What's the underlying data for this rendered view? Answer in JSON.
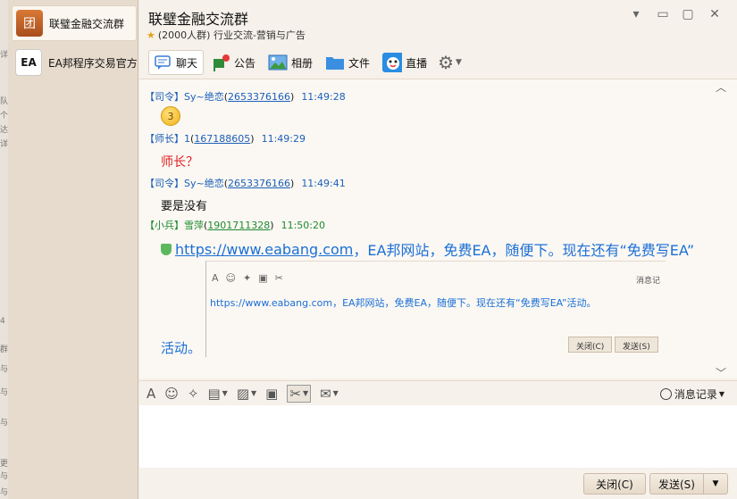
{
  "left_strip": [
    "详",
    "队",
    "个",
    "达",
    "详",
    "4",
    "群",
    "与",
    "与",
    "与",
    "更",
    "与",
    "与"
  ],
  "conversations": [
    {
      "name": "联璧金融交流群",
      "avatar_text": "团",
      "active": true
    },
    {
      "name": "EA邦程序交易官方",
      "avatar_text": "EA",
      "active": false
    }
  ],
  "header": {
    "title": "联璧金融交流群",
    "subtitle": "(2000人群) 行业交流-营销与广告"
  },
  "window_controls": {
    "dropdown": "▾",
    "minimize": "▭",
    "maximize": "▢",
    "close": "✕"
  },
  "tabs": [
    {
      "label": "聊天",
      "icon": "chat-icon"
    },
    {
      "label": "公告",
      "icon": "announcement-icon"
    },
    {
      "label": "相册",
      "icon": "album-icon"
    },
    {
      "label": "文件",
      "icon": "folder-icon"
    },
    {
      "label": "直播",
      "icon": "live-icon"
    }
  ],
  "messages": [
    {
      "rank": "【司令】",
      "name": "Sy~绝恋",
      "id": "2653376166",
      "time": "11:49:28",
      "body": "",
      "emoji": true
    },
    {
      "rank": "【师长】",
      "name": "1",
      "id": "167188605",
      "time": "11:49:29",
      "body": "师长？"
    },
    {
      "rank": "【司令】",
      "name": "Sy~绝恋",
      "id": "2653376166",
      "time": "11:49:41",
      "body": "要是没有"
    },
    {
      "rank": "【小兵】",
      "name": "雪萍",
      "id": "1901711328",
      "time": "11:50:20",
      "body": ""
    }
  ],
  "ea_message": {
    "link": "https://www.eabang.com",
    "text": "，EA邦网站，免费EA，随便下。现在还有“免费写EA”",
    "continuation": "活动。"
  },
  "embedded": {
    "text": "https://www.eabang.com，EA邦网站，免费EA，随便下。现在还有“免费写EA”活动。",
    "record_label": "消息记",
    "close_label": "关闭(C)",
    "send_label": "发送(S)"
  },
  "toolbar": {
    "record_label": "消息记录"
  },
  "buttons": {
    "close": "关闭(C)",
    "send": "发送(S)"
  },
  "colors": {
    "link_blue": "#1b6fd6",
    "meta_blue": "#1b5fb8",
    "meta_green": "#1e8a2d",
    "red_text": "#dd2222"
  }
}
